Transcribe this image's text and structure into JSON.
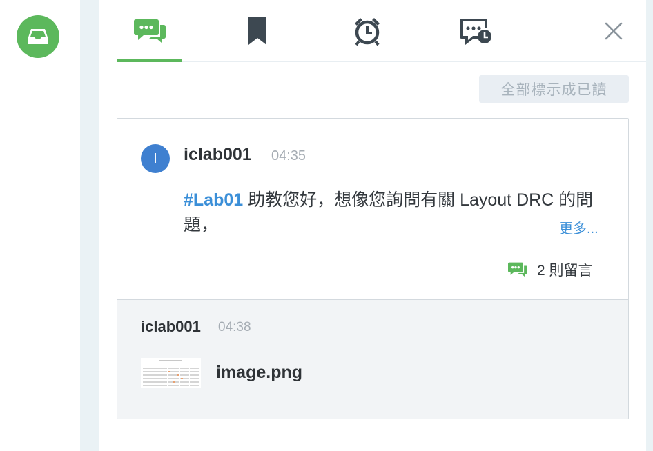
{
  "nav": {
    "inbox_icon": "inbox-icon",
    "brand_color": "#5cb85c"
  },
  "tabs": [
    {
      "icon": "chat-bubbles-icon",
      "active": true
    },
    {
      "icon": "bookmark-icon",
      "active": false
    },
    {
      "icon": "alarm-clock-icon",
      "active": false
    },
    {
      "icon": "scheduled-message-icon",
      "active": false
    }
  ],
  "close_icon": "close-icon",
  "mark_all_read_label": "全部標示成已讀",
  "post": {
    "avatar_initial": "I",
    "author": "iclab001",
    "time": "04:35",
    "hashtag": "#Lab01",
    "text": " 助教您好，想像您詢問有關 Layout DRC 的問題，",
    "more_label": "更多...",
    "comment_count_label": "2 則留言"
  },
  "reply": {
    "author": "iclab001",
    "time": "04:38",
    "attachment_name": "image.png"
  },
  "colors": {
    "accent_green": "#5cb85c",
    "link_blue": "#3b8fd8",
    "avatar_blue": "#3f80d0",
    "muted_gray": "#a5acb3"
  }
}
